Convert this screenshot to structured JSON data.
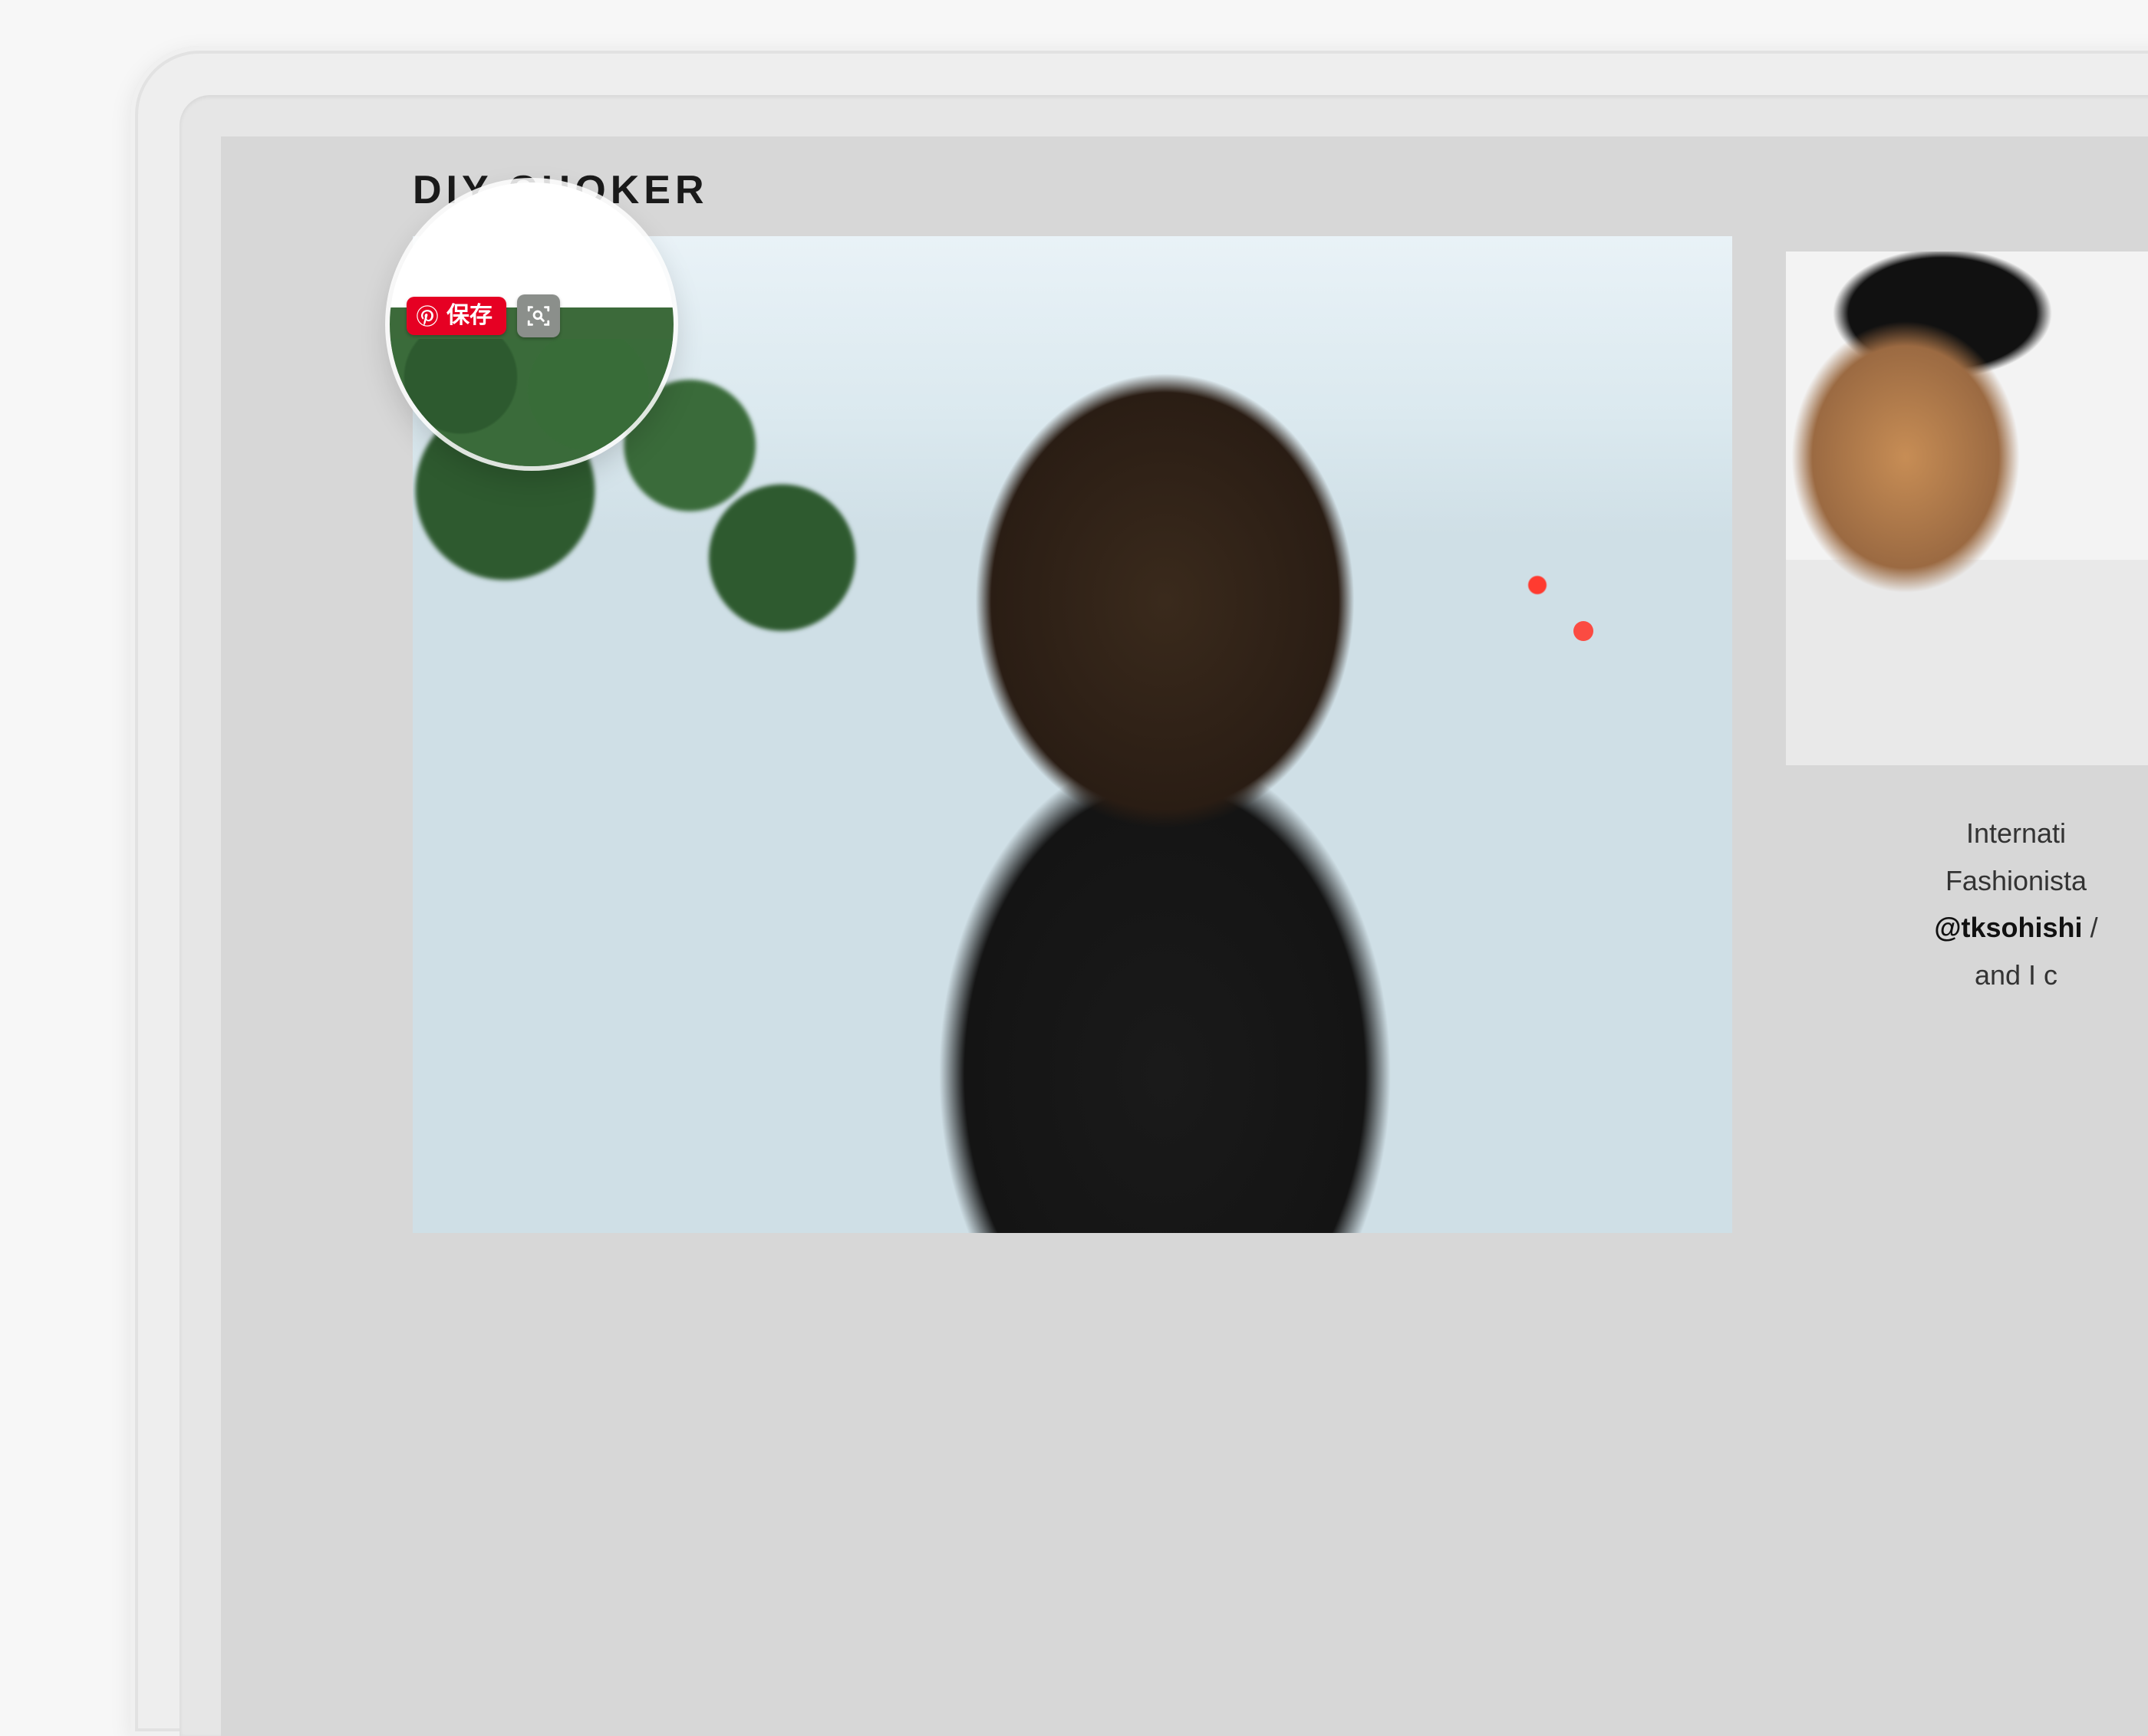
{
  "article": {
    "title": "DIY CHOKER"
  },
  "pinterest": {
    "save_label": "保存"
  },
  "sidebar": {
    "line1": "Internati",
    "line2": "Fashionista",
    "handle": "@tksohishi",
    "handle_suffix": " /",
    "line4": "and I c"
  },
  "icons": {
    "pinterest": "pinterest-icon",
    "visual_search": "visual-search-icon"
  },
  "colors": {
    "pinterest_red": "#e60023",
    "page_bg": "#d7d7d7"
  }
}
